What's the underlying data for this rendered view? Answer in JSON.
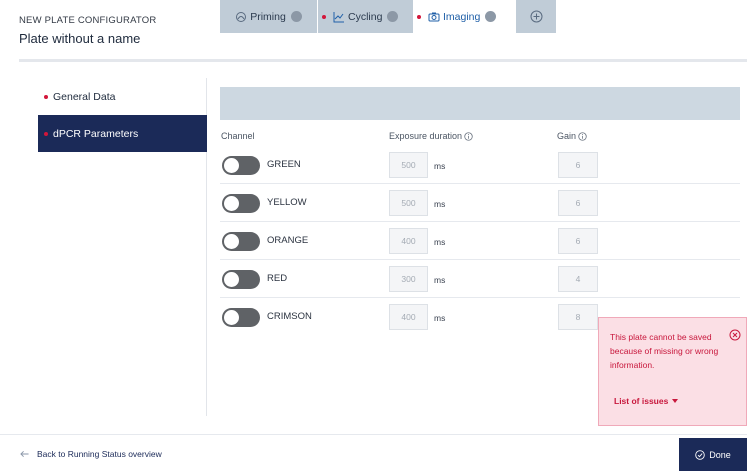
{
  "header": {
    "sup_title": "NEW PLATE CONFIGURATOR",
    "title": "Plate without a name"
  },
  "sidebar": {
    "items": [
      {
        "label": "General Data"
      },
      {
        "label": "dPCR Parameters"
      }
    ]
  },
  "tabs": [
    {
      "label": "Priming"
    },
    {
      "label": "Cycling"
    },
    {
      "label": "Imaging"
    }
  ],
  "columns": {
    "channel": "Channel",
    "exposure": "Exposure duration",
    "gain": "Gain"
  },
  "unit": "ms",
  "channels": [
    {
      "name": "GREEN",
      "exposure": "500",
      "gain": "6",
      "enabled": false
    },
    {
      "name": "YELLOW",
      "exposure": "500",
      "gain": "6",
      "enabled": false
    },
    {
      "name": "ORANGE",
      "exposure": "400",
      "gain": "6",
      "enabled": false
    },
    {
      "name": "RED",
      "exposure": "300",
      "gain": "4",
      "enabled": false
    },
    {
      "name": "CRIMSON",
      "exposure": "400",
      "gain": "8",
      "enabled": false
    }
  ],
  "error": {
    "message": "This plate cannot be saved because of missing or wrong information.",
    "link": "List of issues"
  },
  "footer": {
    "back": "Back to Running Status overview",
    "done": "Done"
  },
  "colors": {
    "navy": "#1b2a58",
    "error": "#c8173c",
    "error_bg": "#fbdfe5",
    "tabbar": "#cdd8e1",
    "toggle_off": "#5f6266"
  }
}
